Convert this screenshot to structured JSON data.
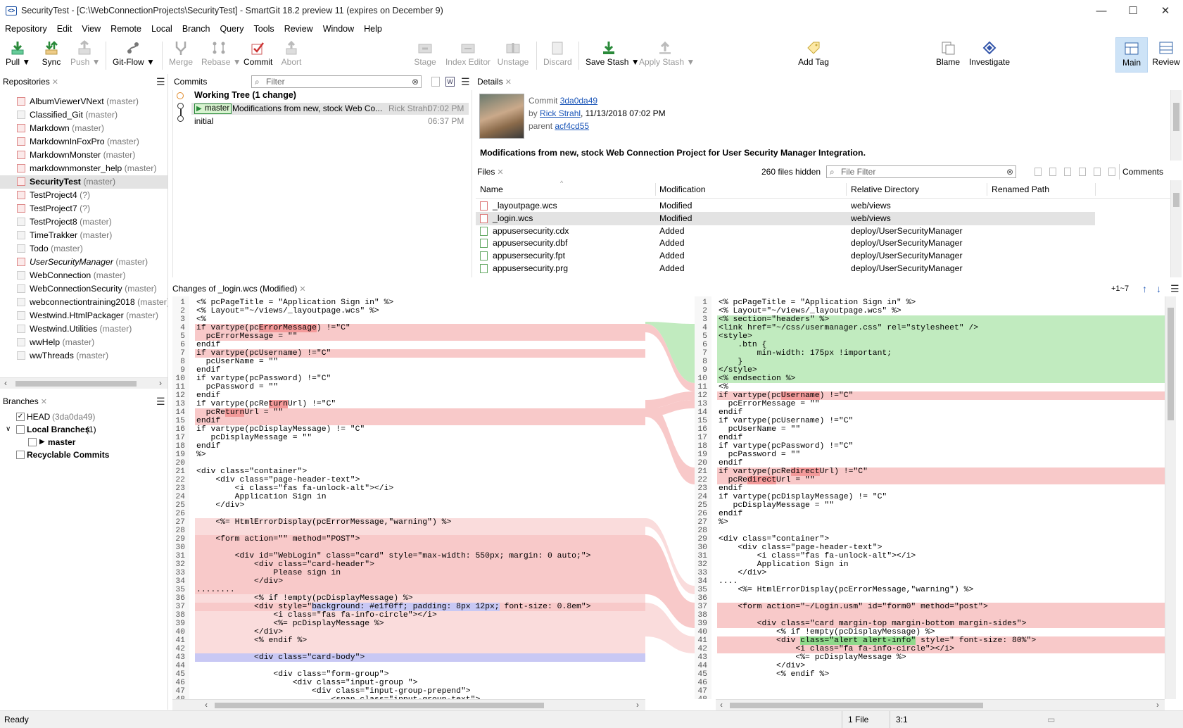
{
  "window": {
    "title": "SecurityTest - [C:\\WebConnectionProjects\\SecurityTest] - SmartGit 18.2 preview 11 (expires on December 9)",
    "app_icon": "<>",
    "min": "—",
    "max": "☐",
    "close": "✕"
  },
  "menu": [
    "Repository",
    "Edit",
    "View",
    "Remote",
    "Local",
    "Branch",
    "Query",
    "Tools",
    "Review",
    "Window",
    "Help"
  ],
  "toolbar": {
    "pull": "Pull ▼",
    "sync": "Sync",
    "push": "Push ▼",
    "gitflow": "Git-Flow ▼",
    "merge": "Merge",
    "rebase": "Rebase ▼",
    "commit": "Commit",
    "abort": "Abort",
    "stage": "Stage",
    "index_editor": "Index Editor",
    "unstage": "Unstage",
    "discard": "Discard",
    "save_stash": "Save Stash ▼",
    "apply_stash": "Apply Stash ▼",
    "add_tag": "Add Tag",
    "blame": "Blame",
    "investigate": "Investigate",
    "main": "Main",
    "review": "Review"
  },
  "repositories": {
    "title": "Repositories",
    "items": [
      {
        "name": "AlbumViewerVNext",
        "branch": "(master)",
        "style": "red"
      },
      {
        "name": "Classified_Git",
        "branch": "(master)",
        "style": ""
      },
      {
        "name": "Markdown",
        "branch": "(master)",
        "style": "red"
      },
      {
        "name": "MarkdownInFoxPro",
        "branch": "(master)",
        "style": "red"
      },
      {
        "name": "MarkdownMonster",
        "branch": "(master)",
        "style": "red"
      },
      {
        "name": "markdownmonster_help",
        "branch": "(master)",
        "style": "red"
      },
      {
        "name": "SecurityTest",
        "branch": "(master)",
        "style": "red sel"
      },
      {
        "name": "TestProject4",
        "branch": "(?)",
        "style": "red"
      },
      {
        "name": "TestProject7",
        "branch": "(?)",
        "style": "red"
      },
      {
        "name": "TestProject8",
        "branch": "(master)",
        "style": ""
      },
      {
        "name": "TimeTrakker",
        "branch": "(master)",
        "style": ""
      },
      {
        "name": "Todo",
        "branch": "(master)",
        "style": ""
      },
      {
        "name": "UserSecurityManager",
        "branch": "(master)",
        "style": "red it"
      },
      {
        "name": "WebConnection",
        "branch": "(master)",
        "style": ""
      },
      {
        "name": "WebConnectionSecurity",
        "branch": "(master)",
        "style": ""
      },
      {
        "name": "webconnectiontraining2018",
        "branch": "(master)",
        "style": ""
      },
      {
        "name": "Westwind.HtmlPackager",
        "branch": "(master)",
        "style": ""
      },
      {
        "name": "Westwind.Utilities",
        "branch": "(master)",
        "style": ""
      },
      {
        "name": "wwHelp",
        "branch": "(master)",
        "style": ""
      },
      {
        "name": "wwThreads",
        "branch": "(master)",
        "style": ""
      }
    ]
  },
  "branches": {
    "title": "Branches",
    "head": "HEAD",
    "head_hash": "(3da0da49)",
    "local": "Local Branches",
    "local_count": "(1)",
    "master": "master",
    "recyclable": "Recyclable Commits"
  },
  "commits": {
    "title": "Commits",
    "filter_placeholder": "Filter",
    "working_tree": "Working Tree (1 change)",
    "rows": [
      {
        "tag": "master",
        "message": "Modifications from new, stock Web Co...",
        "author": "Rick Strahl",
        "time": "07:02 PM"
      },
      {
        "tag": "",
        "message": "initial",
        "author": "",
        "time": "06:37 PM"
      }
    ]
  },
  "details": {
    "title": "Details",
    "commit_label": "Commit",
    "commit_hash": "3da0da49",
    "by_label": "by",
    "author": "Rick Strahl",
    "date": ", 11/13/2018 07:02 PM",
    "parent_label": "parent",
    "parent_hash": "acf4cd55",
    "message": "Modifications from new, stock Web Connection Project for User Security Manager Integration."
  },
  "files": {
    "title": "Files",
    "hidden": "260 files hidden",
    "filter_placeholder": "File Filter",
    "comments": "Comments",
    "columns": [
      "Name",
      "Modification",
      "Relative Directory",
      "Renamed Path"
    ],
    "rows": [
      {
        "name": "_layoutpage.wcs",
        "mod": "Modified",
        "dir": "web/views",
        "kind": "mod"
      },
      {
        "name": "_login.wcs",
        "mod": "Modified",
        "dir": "web/views",
        "kind": "mod"
      },
      {
        "name": "appusersecurity.cdx",
        "mod": "Added",
        "dir": "deploy/UserSecurityManager",
        "kind": "add"
      },
      {
        "name": "appusersecurity.dbf",
        "mod": "Added",
        "dir": "deploy/UserSecurityManager",
        "kind": "add"
      },
      {
        "name": "appusersecurity.fpt",
        "mod": "Added",
        "dir": "deploy/UserSecurityManager",
        "kind": "add"
      },
      {
        "name": "appusersecurity.prg",
        "mod": "Added",
        "dir": "deploy/UserSecurityManager",
        "kind": "add"
      }
    ]
  },
  "diff": {
    "title": "Changes of _login.wcs (Modified)",
    "nav": "+1~7",
    "left": [
      "<% pcPageTitle = \"Application Sign in\" %>",
      "<% Layout=\"~/views/_layoutpage.wcs\" %>",
      "<%",
      "if vartype(pcErrorMessage) !=\"C\"",
      "  pcErrorMessage = \"\"",
      "endif",
      "if vartype(pcUsername) !=\"C\"",
      "  pcUserName = \"\"",
      "endif",
      "if vartype(pcPassword) !=\"C\"",
      "  pcPassword = \"\"",
      "endif",
      "if vartype(pcReturnUrl) !=\"C\"",
      "  pcReturnUrl = \"\"",
      "endif",
      "if vartype(pcDisplayMessage) != \"C\"",
      "   pcDisplayMessage = \"\"",
      "endif",
      "%>",
      "",
      "<div class=\"container\">",
      "    <div class=\"page-header-text\">",
      "        <i class=\"fas fa-unlock-alt\"></i>",
      "        Application Sign in",
      "    </div>",
      "",
      "    <%= HtmlErrorDisplay(pcErrorMessage,\"warning\") %>",
      "",
      "    <form action=\"\" method=\"POST\">",
      "",
      "        <div id=\"WebLogin\" class=\"card\" style=\"max-width: 550px; margin: 0 auto;\">",
      "            <div class=\"card-header\">",
      "                Please sign in",
      "            </div>",
      "........",
      "            <% if !empty(pcDisplayMessage) %>",
      "            <div style=\"background: #e1f0ff; padding: 8px 12px; font-size: 0.8em\">",
      "                <i class=\"fas fa-info-circle\"></i>",
      "                <%= pcDisplayMessage %>",
      "            </div>",
      "            <% endif %>",
      "",
      "            <div class=\"card-body\">",
      "",
      "                <div class=\"form-group\">",
      "                    <div class=\"input-group \">",
      "                        <div class=\"input-group-prepend\">",
      "                            <span class=\"input-group-text\">"
    ],
    "right": [
      "<% pcPageTitle = \"Application Sign in\" %>",
      "<% Layout=\"~/views/_layoutpage.wcs\" %>",
      "<% section=\"headers\" %>",
      "<link href=\"~/css/usermanager.css\" rel=\"stylesheet\" />",
      "<style>",
      "    .btn {",
      "        min-width: 175px !important;",
      "    }",
      "</style>",
      "<% endsection %>",
      "<%",
      "if vartype(pcUsername) !=\"C\"",
      "  pcErrorMessage = \"\"",
      "endif",
      "if vartype(pcUsername) !=\"C\"",
      "  pcUserName = \"\"",
      "endif",
      "if vartype(pcPassword) !=\"C\"",
      "  pcPassword = \"\"",
      "endif",
      "if vartype(pcRedirectUrl) !=\"C\"",
      "  pcRedirectUrl = \"\"",
      "endif",
      "if vartype(pcDisplayMessage) != \"C\"",
      "   pcDisplayMessage = \"\"",
      "endif",
      "%>",
      "",
      "<div class=\"container\">",
      "    <div class=\"page-header-text\">",
      "        <i class=\"fas fa-unlock-alt\"></i>",
      "        Application Sign in",
      "    </div>",
      "....",
      "    <%= HtmlErrorDisplay(pcErrorMessage,\"warning\") %>",
      "",
      "    <form action=\"~/Login.usm\" id=\"form0\" method=\"post\">",
      "",
      "        <div class=\"card margin-top margin-bottom margin-sides\">",
      "            <% if !empty(pcDisplayMessage) %>",
      "            <div class=\"alert alert-info\" style=\" font-size: 80%\">",
      "                <i class=\"fa fa-info-circle\"></i>",
      "                <%= pcDisplayMessage %>",
      "            </div>",
      "            <% endif %>",
      "",
      "",
      ""
    ]
  },
  "status": {
    "text": "Ready",
    "files": "1 File",
    "position": "3:1"
  },
  "colors": {
    "accent": "#1a55b8",
    "diff_red": "#f8c9c9",
    "diff_green": "#c1ebbf",
    "selection": "#cde3f7"
  }
}
